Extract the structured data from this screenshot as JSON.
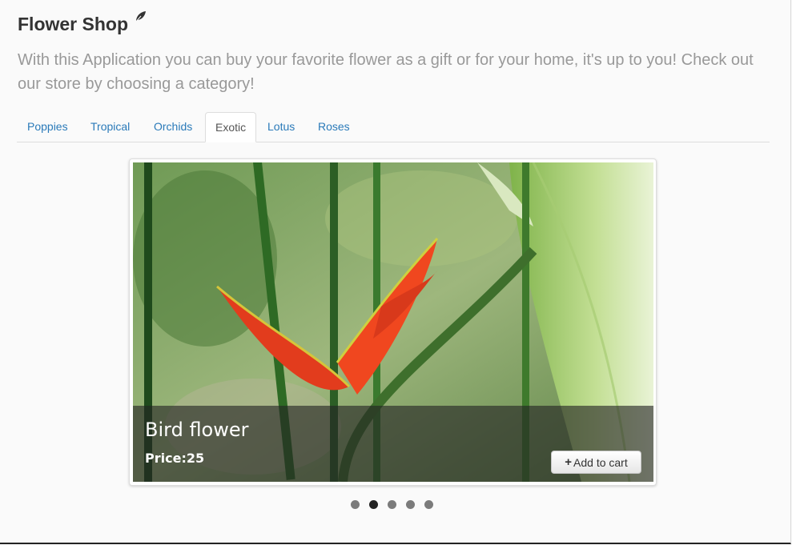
{
  "header": {
    "title": "Flower Shop",
    "intro": "With this Application you can buy your favorite flower as a gift or for your home, it's up to you! Check out our store by choosing a category!"
  },
  "tabs": [
    {
      "label": "Poppies"
    },
    {
      "label": "Tropical"
    },
    {
      "label": "Orchids"
    },
    {
      "label": "Exotic",
      "active": true
    },
    {
      "label": "Lotus"
    },
    {
      "label": "Roses"
    }
  ],
  "carousel": {
    "slide": {
      "name": "Bird flower",
      "price": "Price:25",
      "add_to_cart_label": "Add to cart"
    },
    "active_indicator": 2,
    "indicator_count": 5
  },
  "colors": {
    "link": "#2a7ab9",
    "intro_text": "#999999",
    "title_text": "#333333"
  },
  "icons": {
    "title_decoration": "leaf-icon",
    "cart_button": "plus-icon"
  }
}
